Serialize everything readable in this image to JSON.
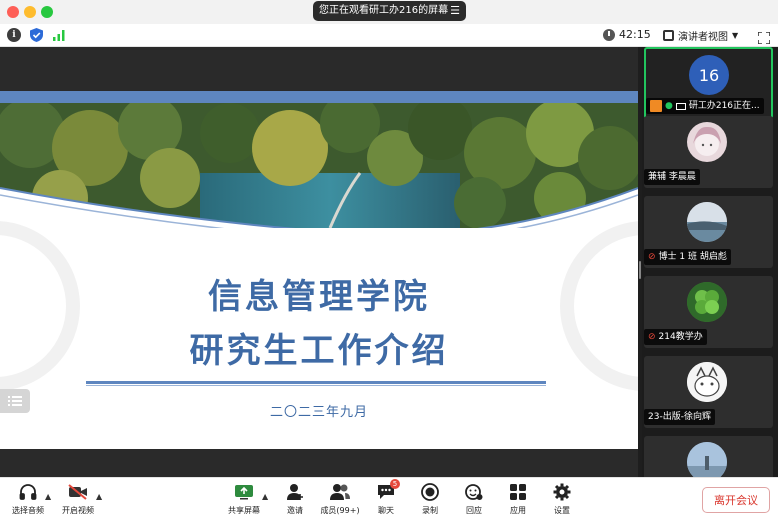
{
  "window": {
    "share_banner": "您正在观看研工办216的屏幕"
  },
  "infobar": {
    "timer": "42:15",
    "presenter_view": "演讲者视图"
  },
  "slide": {
    "title_line1": "信息管理学院",
    "title_line2": "研究生工作介绍",
    "date": "二〇二三年九月"
  },
  "participants": [
    {
      "avatar_text": "16",
      "name": "研工办216正在...",
      "active": true
    },
    {
      "avatar_text": "",
      "name": "兼辅 李晨晨",
      "active": false
    },
    {
      "avatar_text": "",
      "name": "博士 1 班 胡启彪",
      "active": false
    },
    {
      "avatar_text": "",
      "name": "214教学办",
      "active": false
    },
    {
      "avatar_text": "",
      "name": "23-出版-徐向辉",
      "active": false
    },
    {
      "avatar_text": "",
      "name": "",
      "active": false
    }
  ],
  "toolbar": {
    "audio_label": "选择音频",
    "video_label": "开启视频",
    "share_label": "共享屏幕",
    "invite_label": "邀请",
    "members_label": "成员(99+)",
    "chat_label": "聊天",
    "chat_badge": "5",
    "record_label": "录制",
    "reactions_label": "回应",
    "apps_label": "应用",
    "settings_label": "设置",
    "leave_label": "离开会议"
  },
  "colors": {
    "accent_green": "#22c55e",
    "slide_blue": "#3e6aa5",
    "leave_red": "#d9342b"
  }
}
